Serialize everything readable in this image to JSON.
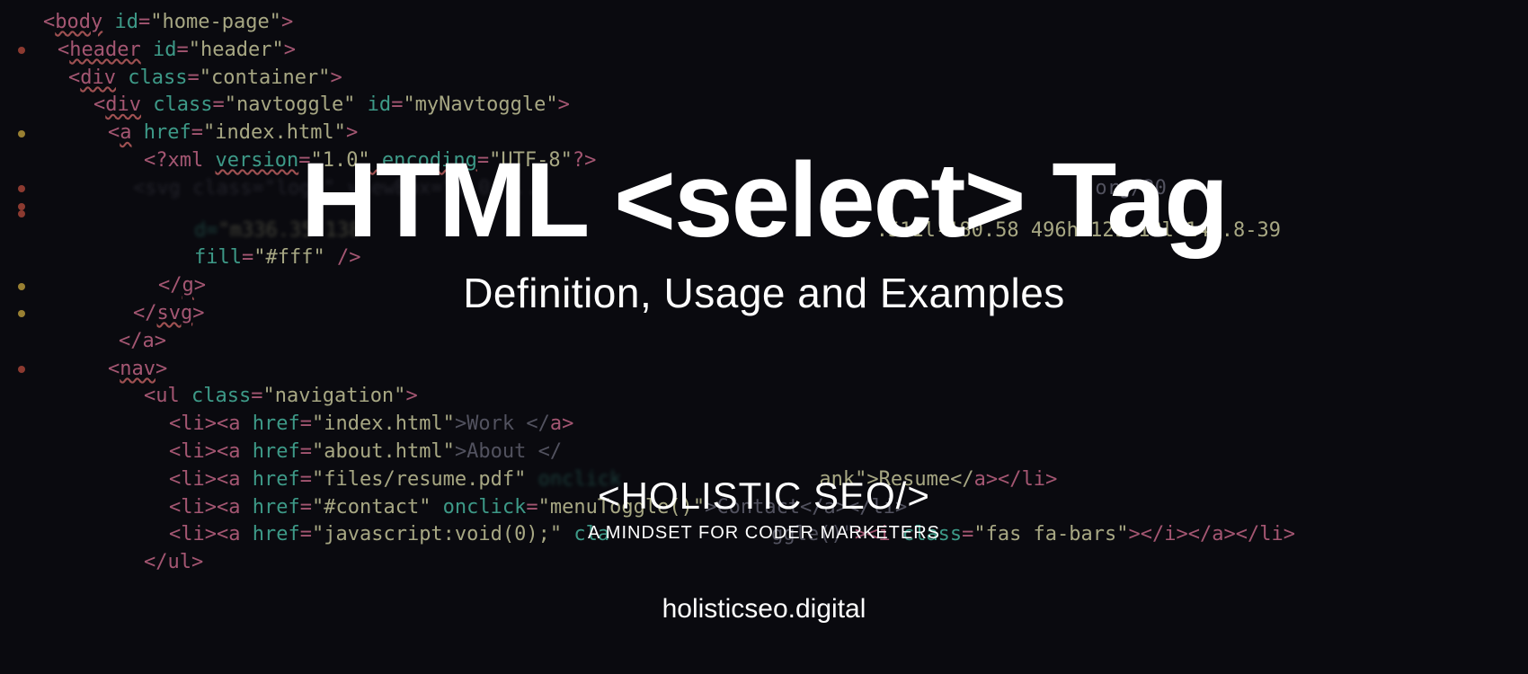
{
  "hero": {
    "title": "HTML <select> Tag",
    "subtitle": "Definition, Usage and Examples"
  },
  "brand": {
    "name": "<HOLISTIC SEO/>",
    "tagline": "A MINDSET FOR CODER  MARKETERS",
    "domain": "holisticseo.digital"
  },
  "code": {
    "l1_a": "<",
    "l1_b": "body",
    "l1_c": " id",
    "l1_d": "=",
    "l1_e": "\"home-page\"",
    "l1_f": ">",
    "l2_a": "<",
    "l2_b": "header",
    "l2_c": " id",
    "l2_d": "=",
    "l2_e": "\"header\"",
    "l2_f": ">",
    "l3_a": "<",
    "l3_b": "div",
    "l3_c": " class",
    "l3_d": "=",
    "l3_e": "\"container\"",
    "l3_f": ">",
    "l4_a": "<",
    "l4_b": "div",
    "l4_c": " class",
    "l4_d": "=",
    "l4_e": "\"navtoggle\"",
    "l4_f": " id",
    "l4_g": "=",
    "l4_h": "\"myNavtoggle\"",
    "l4_i": ">",
    "l5_a": "<",
    "l5_b": "a",
    "l5_c": " href",
    "l5_d": "=",
    "l5_e": "\"index.html\"",
    "l5_f": ">",
    "l6_a": "<?xml ",
    "l6_b": "version",
    "l6_c": "=",
    "l6_d": "\"1.0\"",
    "l6_e": " encoding",
    "l6_f": "=",
    "l6_g": "\"UTF-8\"",
    "l6_h": "?>",
    "l7": "<svg class=\"logo\" viewBox=\"0 0 ...",
    "l8": "org/20",
    "l9_a": "d=",
    "l9_b": "\"m336.35 138 ",
    "l9_c": ".511l-180.58 496h-129.18l-144.8-39",
    "l10_a": "fill",
    "l10_b": "=",
    "l10_c": "\"#fff\"",
    "l10_d": " />",
    "l11_a": "</",
    "l11_b": "g",
    "l11_c": ">",
    "l12_a": "</",
    "l12_b": "svg",
    "l12_c": ">",
    "l13_a": "</",
    "l13_b": "a",
    "l13_c": ">",
    "l14_a": "<",
    "l14_b": "nav",
    "l14_c": ">",
    "l15_a": "<",
    "l15_b": "ul",
    "l15_c": " class",
    "l15_d": "=",
    "l15_e": "\"navigation\"",
    "l15_f": ">",
    "l16_a": "<",
    "l16_b": "li",
    "l16_c": "><",
    "l16_d": "a",
    "l16_e": " href",
    "l16_f": "=",
    "l16_g": "\"index.html\"",
    "l16_h": ">Work </",
    "l16_i": "a",
    "l16_j": ">",
    "l17_a": "<",
    "l17_b": "li",
    "l17_c": "><",
    "l17_d": "a",
    "l17_e": " href",
    "l17_f": "=",
    "l17_g": "\"about.html\"",
    "l17_h": ">About </",
    "l18_a": "<",
    "l18_b": "li",
    "l18_c": "><",
    "l18_d": "a",
    "l18_e": " href",
    "l18_f": "=",
    "l18_g": "\"files/resume.pdf\"",
    "l18_h": " onclick",
    "l18_tail": "ank\">Resume</",
    "l18_i": "a",
    "l18_j": "></",
    "l18_k": "li",
    "l18_l": ">",
    "l19_a": "<",
    "l19_b": "li",
    "l19_c": "><",
    "l19_d": "a",
    "l19_e": " href",
    "l19_f": "=",
    "l19_g": "\"#contact\"",
    "l19_h": " onclick",
    "l19_i": "=",
    "l19_j": "\"menuToggle()\"",
    "l19_k": ">Contact</",
    "l19_l": "a",
    "l19_m": "></",
    "l19_n": "li",
    "l19_o": ">",
    "l20_a": "<",
    "l20_b": "li",
    "l20_c": "><",
    "l20_d": "a",
    "l20_e": " href",
    "l20_f": "=",
    "l20_g": "\"javascript:void(0);\"",
    "l20_h": " cla",
    "l20_mid": "ggle()\"",
    "l20_i": "><",
    "l20_j": "i",
    "l20_k": " class",
    "l20_l": "=",
    "l20_m": "\"fas fa-bars\"",
    "l20_n": "></",
    "l20_o": "i",
    "l20_p": "></",
    "l20_q": "a",
    "l20_r": "></",
    "l20_s": "li",
    "l20_t": ">",
    "l21_a": "</",
    "l21_b": "ul",
    "l21_c": ">"
  }
}
